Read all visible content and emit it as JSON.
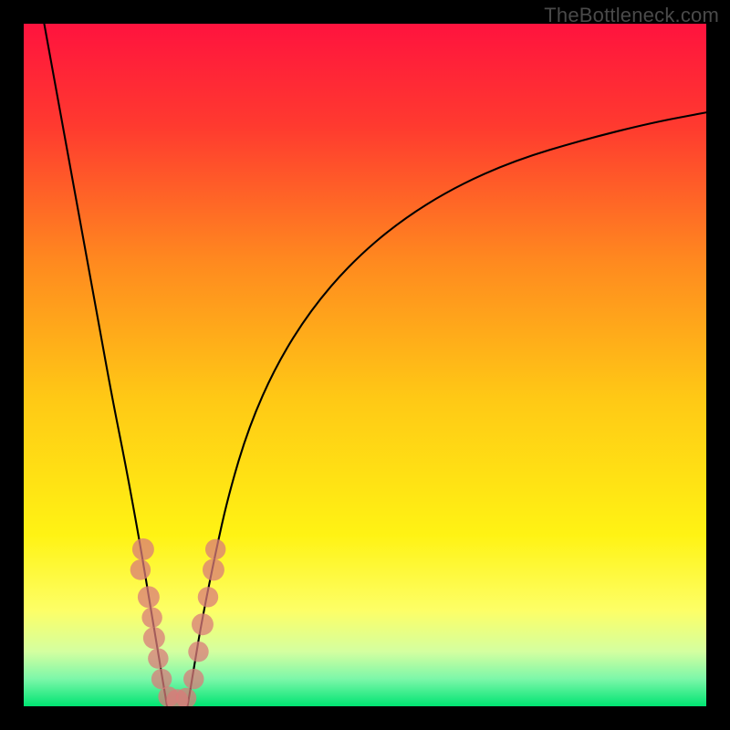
{
  "watermark": "TheBottleneck.com",
  "chart_data": {
    "type": "line",
    "title": "",
    "xlabel": "",
    "ylabel": "",
    "xlim": [
      0,
      100
    ],
    "ylim": [
      0,
      100
    ],
    "grid": false,
    "legend": false,
    "background_gradient_stops": [
      {
        "pos": 0.0,
        "color": "#ff133e"
      },
      {
        "pos": 0.15,
        "color": "#ff3a2f"
      },
      {
        "pos": 0.35,
        "color": "#ff8a1f"
      },
      {
        "pos": 0.55,
        "color": "#ffc915"
      },
      {
        "pos": 0.75,
        "color": "#fff314"
      },
      {
        "pos": 0.86,
        "color": "#fdff67"
      },
      {
        "pos": 0.92,
        "color": "#d4ffa0"
      },
      {
        "pos": 0.96,
        "color": "#7cf7a9"
      },
      {
        "pos": 1.0,
        "color": "#00e472"
      }
    ],
    "series": [
      {
        "name": "left_branch",
        "x": [
          3,
          5,
          7,
          9,
          11,
          13,
          15,
          17,
          18,
          19,
          20,
          21
        ],
        "values": [
          100,
          89,
          78,
          67,
          56,
          45,
          35,
          24,
          18,
          12,
          6,
          0
        ]
      },
      {
        "name": "right_branch",
        "x": [
          24,
          25,
          26,
          28,
          30,
          33,
          37,
          42,
          48,
          55,
          63,
          72,
          82,
          92,
          100
        ],
        "values": [
          0,
          6,
          12,
          22,
          31,
          41,
          50,
          58,
          65,
          71,
          76,
          80,
          83,
          85.5,
          87
        ]
      }
    ],
    "markers": [
      {
        "x": 17.5,
        "y": 23,
        "r": 1.6
      },
      {
        "x": 17.1,
        "y": 20,
        "r": 1.5
      },
      {
        "x": 18.3,
        "y": 16,
        "r": 1.6
      },
      {
        "x": 18.8,
        "y": 13,
        "r": 1.5
      },
      {
        "x": 19.1,
        "y": 10,
        "r": 1.6
      },
      {
        "x": 19.7,
        "y": 7,
        "r": 1.5
      },
      {
        "x": 20.2,
        "y": 4,
        "r": 1.5
      },
      {
        "x": 21.2,
        "y": 1.4,
        "r": 1.5
      },
      {
        "x": 22.5,
        "y": 0.9,
        "r": 1.6
      },
      {
        "x": 23.8,
        "y": 1.2,
        "r": 1.5
      },
      {
        "x": 24.9,
        "y": 4,
        "r": 1.5
      },
      {
        "x": 25.6,
        "y": 8,
        "r": 1.5
      },
      {
        "x": 26.2,
        "y": 12,
        "r": 1.6
      },
      {
        "x": 27.0,
        "y": 16,
        "r": 1.5
      },
      {
        "x": 27.8,
        "y": 20,
        "r": 1.6
      },
      {
        "x": 28.1,
        "y": 23,
        "r": 1.5
      }
    ],
    "marker_color": "#d97b79"
  }
}
